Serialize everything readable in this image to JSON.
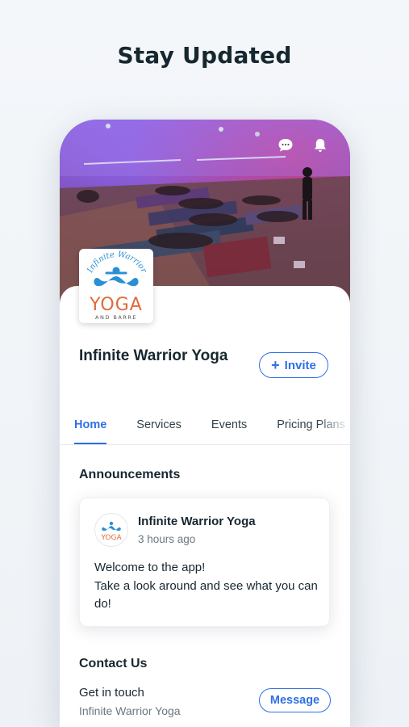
{
  "headline": "Stay Updated",
  "business": {
    "name": "Infinite Warrior Yoga",
    "logo_text": {
      "top": "Infinite Warrior",
      "main": "YOGA",
      "sub": "AND BARRE"
    }
  },
  "header_icons": [
    "chat-bubble-icon",
    "bell-icon"
  ],
  "invite_button": {
    "icon": "+",
    "label": "Invite"
  },
  "tabs": [
    {
      "label": "Home",
      "active": true
    },
    {
      "label": "Services",
      "active": false
    },
    {
      "label": "Events",
      "active": false
    },
    {
      "label": "Pricing Plans",
      "active": false
    }
  ],
  "announcements": {
    "title": "Announcements",
    "post": {
      "author": "Infinite Warrior Yoga",
      "time": "3 hours ago",
      "body_line1": "Welcome to the app!",
      "body_line2": "Take a look around and see what you can do!"
    }
  },
  "contact": {
    "title": "Contact Us",
    "line1": "Get in touch",
    "line2": "Infinite Warrior Yoga",
    "button": "Message"
  },
  "colors": {
    "accent": "#2f6fe6",
    "logo_blue": "#2a8fd4",
    "logo_orange": "#e06a3a",
    "text_dark": "#17272f",
    "text_muted": "#6b7880"
  }
}
